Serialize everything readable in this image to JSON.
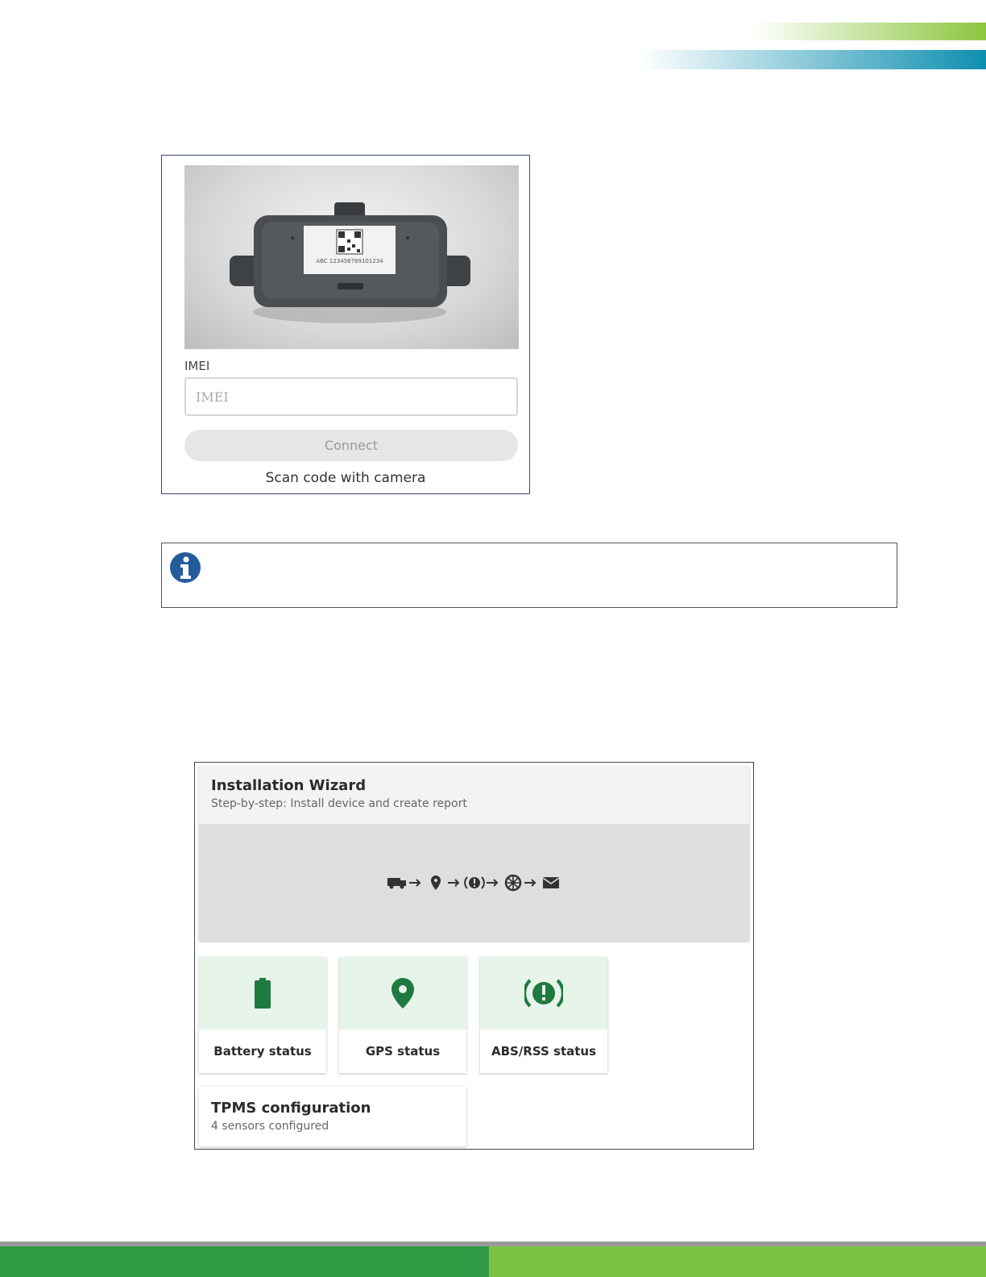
{
  "colors": {
    "brand_green": "#2f9a44",
    "light_green": "#7cc242",
    "brand_blue": "#0e8fb0",
    "icon_green": "#1e7a3f",
    "info_blue": "#245b9a"
  },
  "imei_screen": {
    "device_label": "ABC 123456789101234",
    "field_label": "IMEI",
    "input_placeholder": "IMEI",
    "input_value": "",
    "connect_label": "Connect",
    "scan_label": "Scan code with camera"
  },
  "info_note": {
    "icon": "info-icon",
    "text": ""
  },
  "wizard": {
    "title": "Installation Wizard",
    "subtitle": "Step-by-step: Install device and create report",
    "flow_icons": [
      "truck-icon",
      "location-pin-icon",
      "brake-warning-icon",
      "wheel-icon",
      "envelope-icon"
    ],
    "tiles": [
      {
        "label": "Battery status",
        "icon": "battery-icon"
      },
      {
        "label": "GPS status",
        "icon": "location-pin-icon"
      },
      {
        "label": "ABS/RSS status",
        "icon": "brake-warning-icon"
      }
    ],
    "tpms": {
      "title": "TPMS configuration",
      "subtitle": "4 sensors configured"
    }
  }
}
